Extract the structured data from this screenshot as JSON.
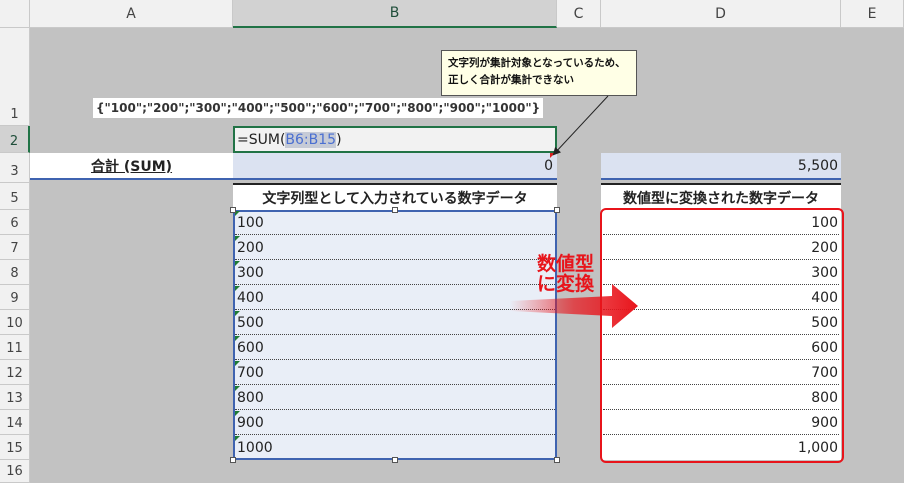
{
  "columns": [
    "A",
    "B",
    "C",
    "D",
    "E"
  ],
  "rows": [
    "1",
    "2",
    "3",
    "5",
    "6",
    "7",
    "8",
    "9",
    "10",
    "11",
    "12",
    "13",
    "14",
    "15",
    "16"
  ],
  "a1_text": "{\"100\";\"200\";\"300\";\"400\";\"500\";\"600\";\"700\";\"800\";\"900\";\"1000\"}",
  "b2_formula_prefix": "=SUM(",
  "b2_formula_ref": "B6:B15",
  "b2_formula_suffix": ")",
  "a3_label": "合計 (SUM)",
  "b3_value": "0",
  "d3_value": "5,500",
  "b5_header": "文字列型として入力されている数字データ",
  "d5_header": "数値型に変換された数字データ",
  "b_values": [
    "100",
    "200",
    "300",
    "400",
    "500",
    "600",
    "700",
    "800",
    "900",
    "1000"
  ],
  "d_values": [
    "100",
    "200",
    "300",
    "400",
    "500",
    "600",
    "700",
    "800",
    "900",
    "1,000"
  ],
  "callout_text_line1": "文字列が集計対象となっているため、",
  "callout_text_line2": "正しく合計が集計できない",
  "arrow_label_line1": "数値型",
  "arrow_label_line2": "に変換",
  "colors": {
    "selection_green": "#217346",
    "red_highlight": "#e8141b",
    "ref_blue": "#4a6fd1"
  }
}
